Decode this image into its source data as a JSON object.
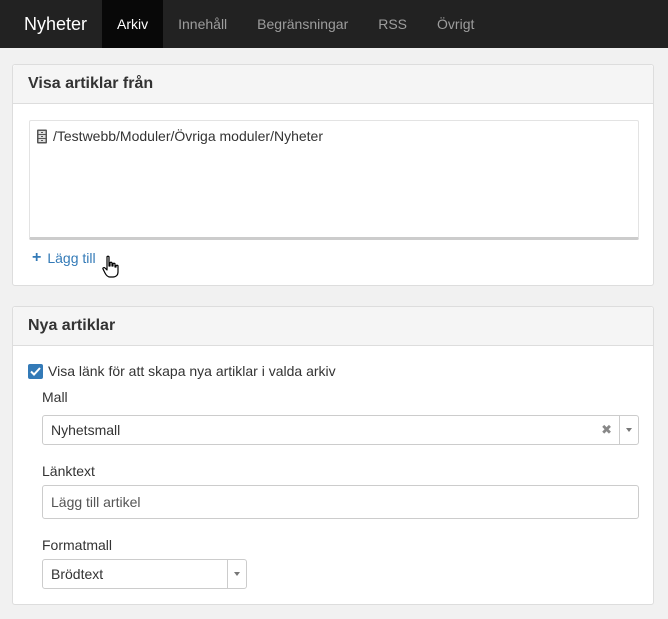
{
  "nav": {
    "brand": "Nyheter",
    "tabs": [
      {
        "label": "Arkiv",
        "active": true
      },
      {
        "label": "Innehåll",
        "active": false
      },
      {
        "label": "Begränsningar",
        "active": false
      },
      {
        "label": "RSS",
        "active": false
      },
      {
        "label": "Övrigt",
        "active": false
      }
    ]
  },
  "archive_panel": {
    "title": "Visa artiklar från",
    "items": [
      "/Testwebb/Moduler/Övriga moduler/Nyheter"
    ],
    "add_label": "Lägg till"
  },
  "new_panel": {
    "title": "Nya artiklar",
    "checkbox_label": "Visa länk för att skapa nya artiklar i valda arkiv",
    "checkbox_checked": true,
    "template_label": "Mall",
    "template_value": "Nyhetsmall",
    "linktext_label": "Länktext",
    "linktext_value": "Lägg till artikel",
    "format_label": "Formatmall",
    "format_value": "Brödtext"
  },
  "colors": {
    "accent": "#337ab7",
    "navbar": "#222222"
  }
}
